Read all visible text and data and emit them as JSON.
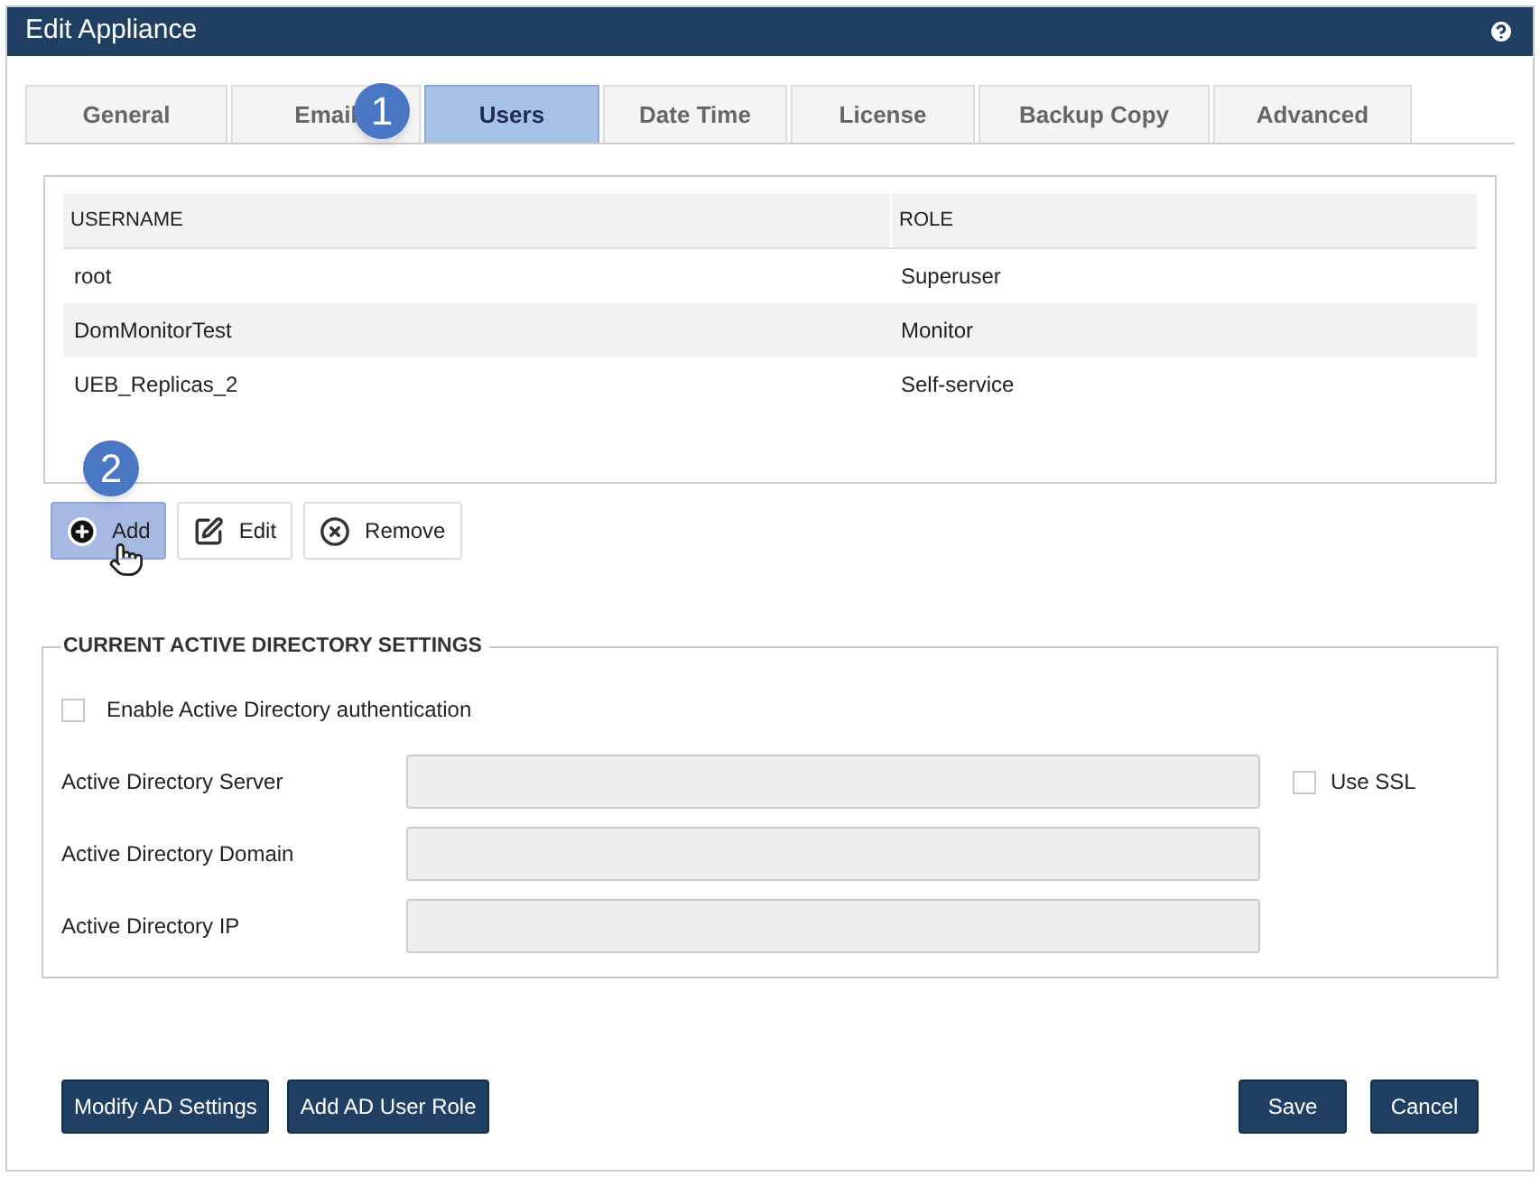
{
  "window": {
    "title": "Edit Appliance"
  },
  "tabs": [
    {
      "label": "General",
      "selected": false
    },
    {
      "label": "Email",
      "selected": false
    },
    {
      "label": "Users",
      "selected": true
    },
    {
      "label": "Date Time",
      "selected": false
    },
    {
      "label": "License",
      "selected": false
    },
    {
      "label": "Backup Copy",
      "selected": false
    },
    {
      "label": "Advanced",
      "selected": false
    }
  ],
  "callouts": [
    {
      "number": "1"
    },
    {
      "number": "2"
    }
  ],
  "table": {
    "columns": [
      "USERNAME",
      "ROLE"
    ],
    "rows": [
      [
        "root",
        "Superuser"
      ],
      [
        "DomMonitorTest",
        "Monitor"
      ],
      [
        "UEB_Replicas_2",
        "Self-service"
      ]
    ]
  },
  "actions": [
    {
      "kind": "add",
      "label": "Add",
      "highlighted": true
    },
    {
      "kind": "edit",
      "label": "Edit",
      "highlighted": false
    },
    {
      "kind": "remove",
      "label": "Remove",
      "highlighted": false
    }
  ],
  "ad_settings": {
    "title": "CURRENT ACTIVE DIRECTORY SETTINGS",
    "enable": {
      "label": "Enable Active Directory authentication",
      "checked": false
    },
    "fields": [
      {
        "label": "Active Directory Server",
        "ssl": {
          "label": "Use SSL",
          "checked": false
        }
      },
      {
        "label": "Active Directory Domain"
      },
      {
        "label": "Active Directory IP"
      }
    ]
  },
  "footer_left": [
    "Modify AD Settings",
    "Add AD User Role"
  ],
  "footer_right": [
    "Save",
    "Cancel"
  ]
}
